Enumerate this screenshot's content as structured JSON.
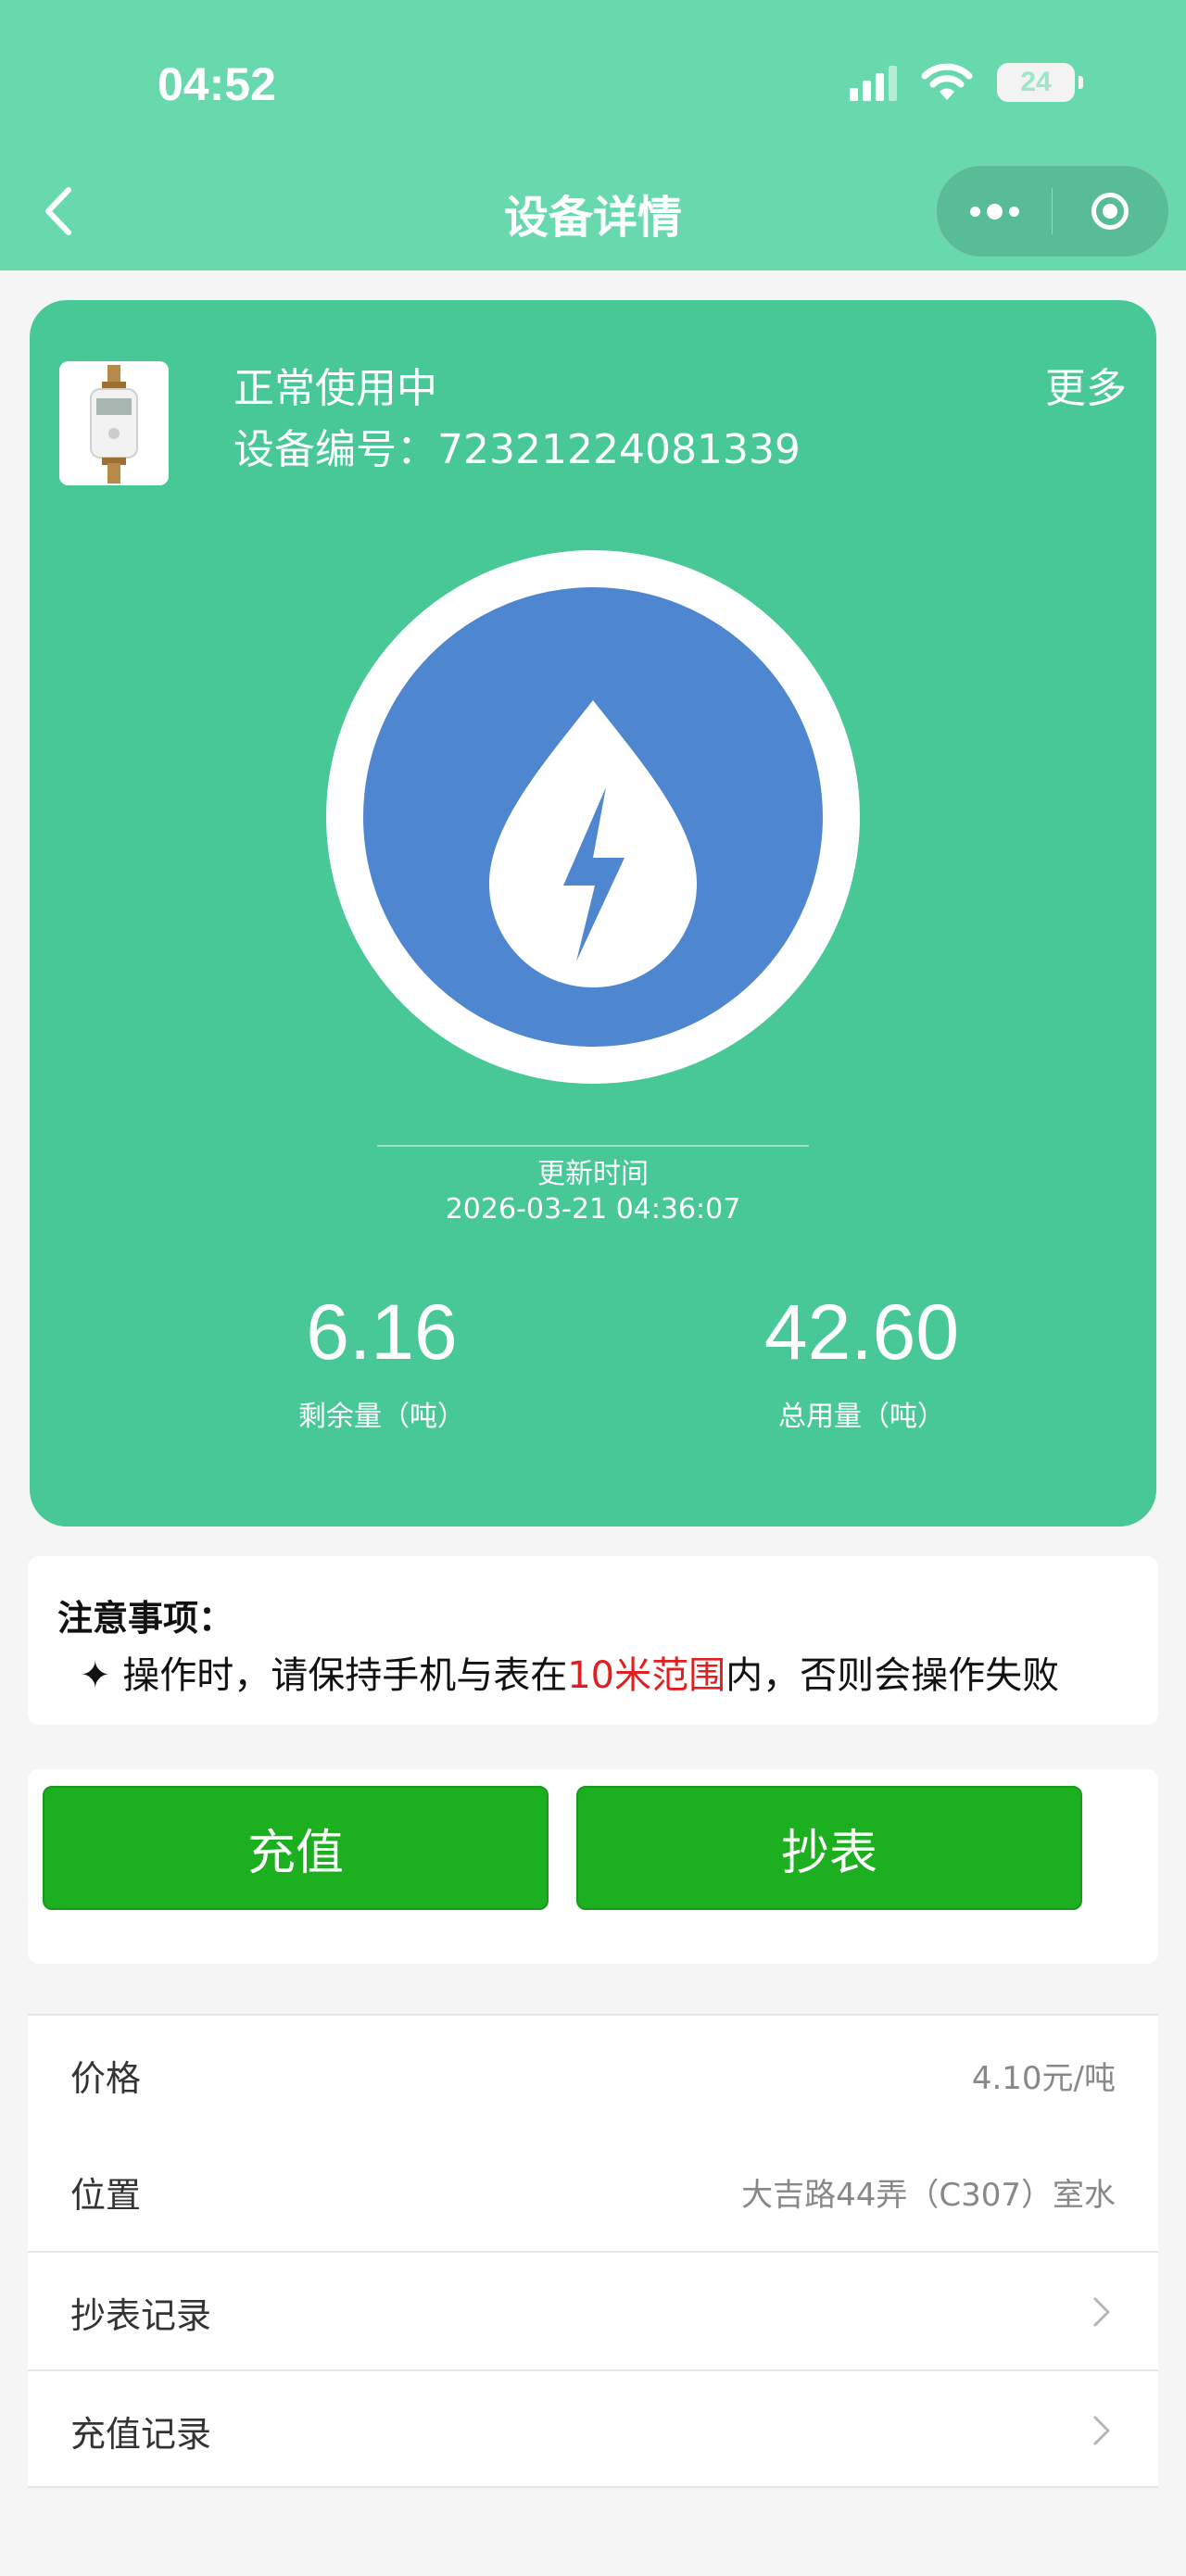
{
  "status_bar": {
    "time": "04:52",
    "battery": "24"
  },
  "nav": {
    "title": "设备详情"
  },
  "device": {
    "status": "正常使用中",
    "id_label": "设备编号：",
    "id_value": "72321224081339",
    "more": "更多",
    "update_label": "更新时间",
    "update_time": "2026-03-21 04:36:07",
    "remaining_value": "6.16",
    "remaining_label": "剩余量（吨）",
    "total_value": "42.60",
    "total_label": "总用量（吨）"
  },
  "notice": {
    "title": "注意事项：",
    "bullet": "✦",
    "text_before": "操作时，请保持手机与表在",
    "text_highlight": "10米范围",
    "text_after": "内，否则会操作失败"
  },
  "actions": {
    "recharge": "充值",
    "read_meter": "抄表"
  },
  "info": {
    "price_label": "价格",
    "price_value": "4.10元/吨",
    "location_label": "位置",
    "location_value": "大吉路44弄（C307）室水",
    "read_records": "抄表记录",
    "recharge_records": "充值记录"
  },
  "colors": {
    "header": "#68d8ad",
    "card": "#48c896",
    "button": "#1caf1f",
    "circle": "#4e86d0",
    "highlight": "#e02020"
  }
}
